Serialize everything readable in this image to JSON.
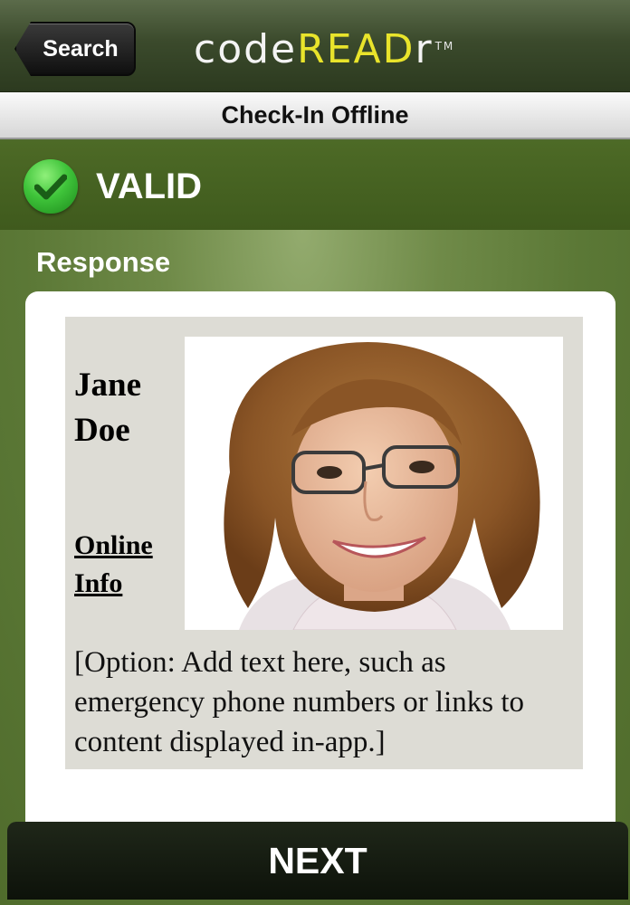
{
  "navbar": {
    "back_label": "Search",
    "logo": {
      "part1": "code",
      "part2": "READ",
      "part3": "r",
      "trademark": "TM"
    }
  },
  "subbar": {
    "title": "Check-In Offline"
  },
  "status": {
    "text": "VALID",
    "icon": "check-circle-icon",
    "color": "#3fc43a"
  },
  "response": {
    "label": "Response",
    "name_line1": "Jane",
    "name_line2": "Doe",
    "link_line1": "Online",
    "link_line2": "Info",
    "note": "[Option: Add text here, such as emergency phone numbers or links to content displayed in-app.]"
  },
  "footer": {
    "next_label": "NEXT"
  },
  "colors": {
    "brand_green": "#4d6a26",
    "logo_yellow": "#e9e42b"
  }
}
